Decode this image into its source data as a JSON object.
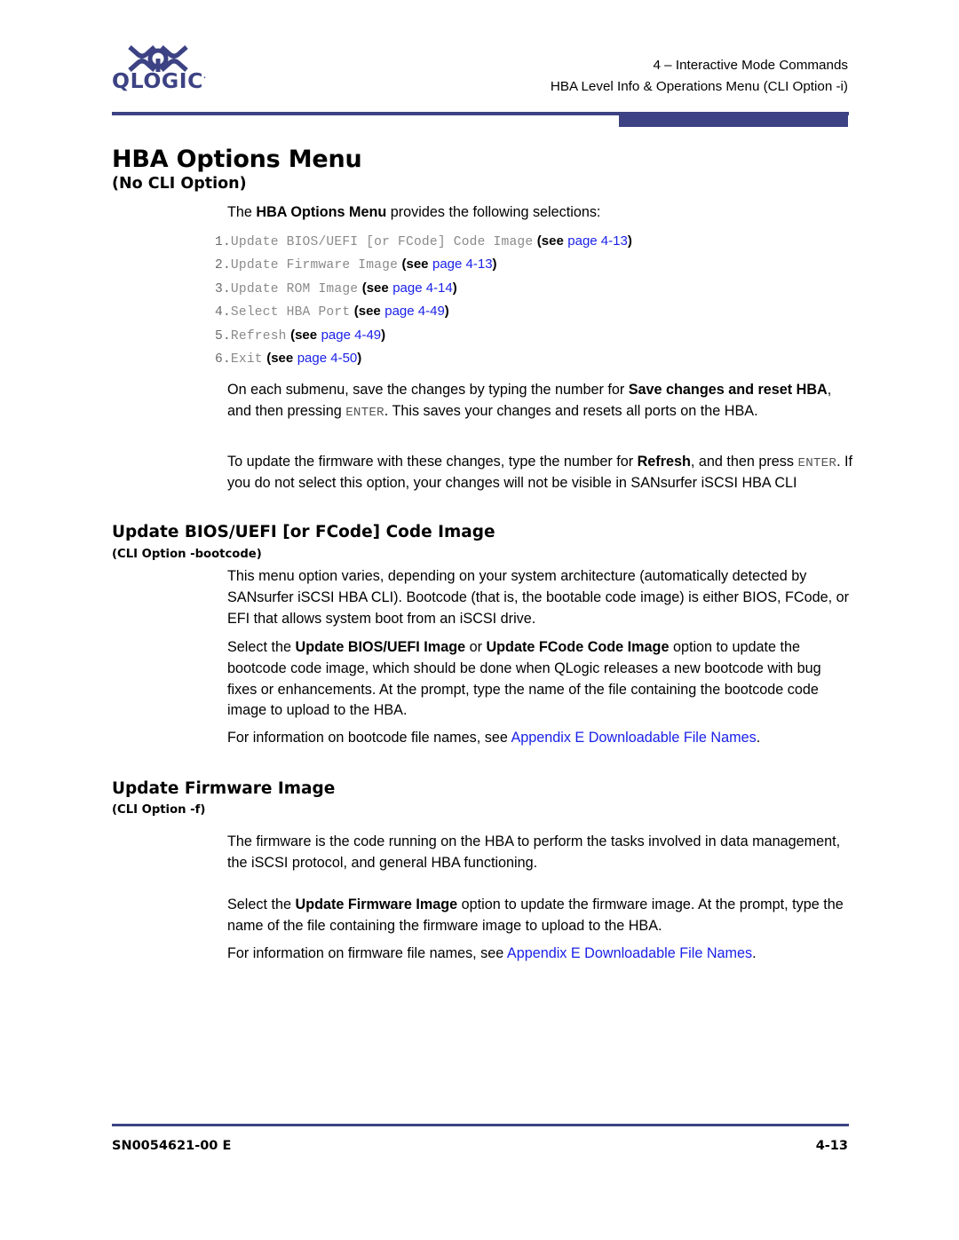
{
  "brand": {
    "name": "QLOGIC",
    "trademark": "·",
    "logo_color": "#3c4283",
    "mark_icon": "qlogic-double-x-mark"
  },
  "header": {
    "line1": "4 – Interactive Mode Commands",
    "line2": "HBA Level Info & Operations Menu (CLI Option -i)"
  },
  "title": {
    "heading": "HBA Options Menu",
    "subheading": "(No CLI Option)"
  },
  "intro": {
    "before": "The ",
    "bold": "HBA Options Menu",
    "after": " provides the following selections:"
  },
  "menu_items": [
    {
      "num": "1.",
      "command": "Update BIOS/UEFI [or FCode] Code Image",
      "see": "(see",
      "page": "page 4-13",
      "close": ")"
    },
    {
      "num": "2.",
      "command": "Update Firmware Image",
      "see": "(see",
      "page": "page 4-13",
      "close": ")"
    },
    {
      "num": "3.",
      "command": "Update ROM Image",
      "see": "(see",
      "page": "page 4-14",
      "close": ")"
    },
    {
      "num": "4.",
      "command": "Select HBA Port",
      "see": "(see",
      "page": "page 4-49",
      "close": ")"
    },
    {
      "num": "5.",
      "command": "Refresh",
      "see": "(see",
      "page": "page 4-49",
      "close": ")"
    },
    {
      "num": "6.",
      "command": "Exit",
      "see": "(see",
      "page": "page 4-50",
      "close": ")"
    }
  ],
  "paragraphs": {
    "submenu_p1_a": "On each submenu, save the changes by typing the number for ",
    "submenu_p1_b": "Save changes and reset HBA",
    "submenu_p1_c": ", and then pressing ",
    "submenu_p1_mono": "ENTER",
    "submenu_p1_d": ". This saves your changes and resets all ports on the HBA.",
    "refresh_p_a": "To update the firmware with these changes, type the number for ",
    "refresh_p_b": "Refresh",
    "refresh_p_c": ", and then press ",
    "refresh_p_mono": "ENTER",
    "refresh_p_d": ". If you do not select this option, your changes will not be visible in SANsurfer iSCSI HBA CLI"
  },
  "section_bootcode": {
    "heading": "Update BIOS/UEFI [or FCode] Code Image",
    "subheading": "(CLI Option -bootcode)",
    "p1": "This menu option varies, depending on your system architecture (automatically detected by SANsurfer iSCSI HBA CLI). Bootcode (that is, the bootable code image) is either BIOS, FCode, or EFI that allows system boot from an iSCSI drive.",
    "p2_a": "Select the ",
    "p2_b1": "Update BIOS/UEFI Image",
    "p2_c": " or ",
    "p2_b2": "Update FCode Code Image",
    "p2_d": " option to update the bootcode code image, which should be done when QLogic releases a new bootcode with bug fixes or enhancements. At the prompt, type the name of the file containing the bootcode code image to upload to the HBA.",
    "p3_a": "For information on bootcode file names, see ",
    "p3_link": "Appendix E Downloadable File Names",
    "p3_b": "."
  },
  "section_firmware": {
    "heading": "Update Firmware Image",
    "subheading": "(CLI Option -f)",
    "p1": "The firmware is the code running on the HBA to perform the tasks involved in data management, the iSCSI protocol, and general HBA functioning.",
    "p2_a": "Select the ",
    "p2_b": "Update Firmware Image",
    "p2_c": " option to update the firmware image. At the prompt, type the name of the file containing the firmware image to upload to the HBA.",
    "p3_a": "For information on firmware file names, see ",
    "p3_link": "Appendix E Downloadable File Names",
    "p3_b": "."
  },
  "footer": {
    "doc_id": "SN0054621-00 E",
    "page_number": "4-13"
  },
  "colors": {
    "accent_blue": "#3c4283",
    "link_blue": "#1a21e8",
    "mono_gray": "#8a8a8a"
  }
}
